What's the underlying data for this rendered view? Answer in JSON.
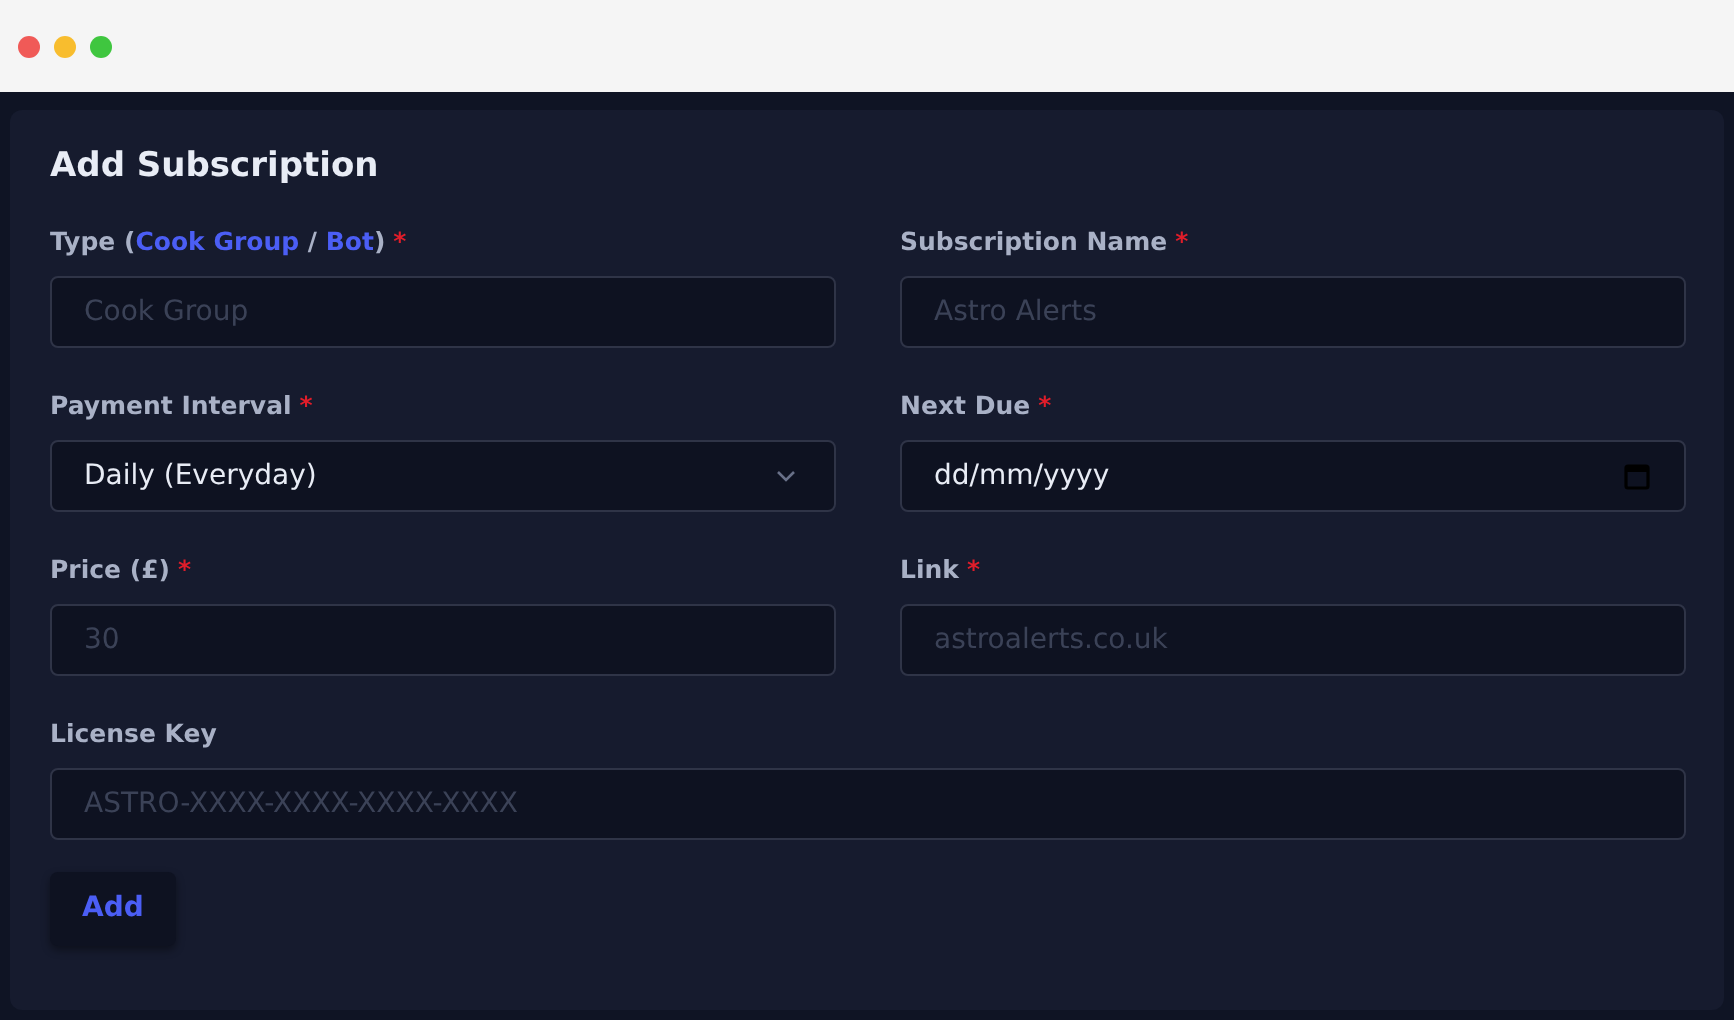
{
  "form": {
    "title": "Add Subscription",
    "fields": [
      {
        "kind": "text",
        "label": [
          {
            "text": "Type (",
            "kind": "plain"
          },
          {
            "text": "Cook Group",
            "kind": "link"
          },
          {
            "text": " / ",
            "kind": "plain"
          },
          {
            "text": "Bot",
            "kind": "link"
          },
          {
            "text": ")",
            "kind": "plain"
          }
        ],
        "required_mark": "*",
        "placeholder": "Cook Group"
      },
      {
        "kind": "text",
        "label": [
          {
            "text": "Subscription Name",
            "kind": "plain"
          }
        ],
        "required_mark": "*",
        "placeholder": "Astro Alerts"
      },
      {
        "kind": "select",
        "label": [
          {
            "text": "Payment Interval",
            "kind": "plain"
          }
        ],
        "required_mark": "*",
        "value": "Daily (Everyday)"
      },
      {
        "kind": "date",
        "label": [
          {
            "text": "Next Due",
            "kind": "plain"
          }
        ],
        "required_mark": "*",
        "value": "dd/mm/yyyy"
      },
      {
        "kind": "text",
        "label": [
          {
            "text": "Price (£)",
            "kind": "plain"
          }
        ],
        "required_mark": "*",
        "placeholder": "30"
      },
      {
        "kind": "text",
        "label": [
          {
            "text": "Link",
            "kind": "plain"
          }
        ],
        "required_mark": "*",
        "placeholder": "astroalerts.co.uk"
      },
      {
        "kind": "wide",
        "label": [
          {
            "text": "License Key",
            "kind": "plain"
          }
        ],
        "placeholder": "ASTRO-XXXX-XXXX-XXXX-XXXX"
      }
    ],
    "submit": "Add"
  }
}
